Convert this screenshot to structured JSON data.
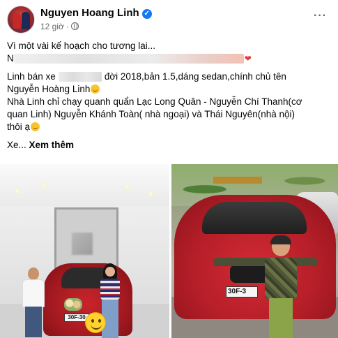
{
  "post": {
    "author": "Nguyen Hoang Linh",
    "time": "12 giờ ·",
    "more_icon": "more-horizontal-icon",
    "verified_icon": "verified-badge-icon",
    "privacy_icon": "globe-icon"
  },
  "text": {
    "line1": "Vì một vài kế hoạch cho tương lai...",
    "line2_prefix": "N",
    "line3_a": "Linh bán xe",
    "line3_b": "đời 2018,bản 1.5,dáng sedan,chính chủ tên",
    "line4": "Nguyễn Hoàng Linh",
    "line5": "Nhà Linh chỉ chạy quanh quẩn Lạc Long Quân - Nguyễn Chí Thanh(cơ",
    "line6": "quan Linh) Nguyễn Khánh Toàn( nhà ngoại) và Thái Nguyên(nhà nội)",
    "line7": "thôi ạ",
    "ellipsis": "Xe...",
    "see_more": "Xem thêm"
  },
  "photos": {
    "left_plate": "30F-30",
    "right_plate": "30F-3"
  },
  "colors": {
    "accent": "#1877f2",
    "meta": "#65676b",
    "car": "#c8242b"
  }
}
